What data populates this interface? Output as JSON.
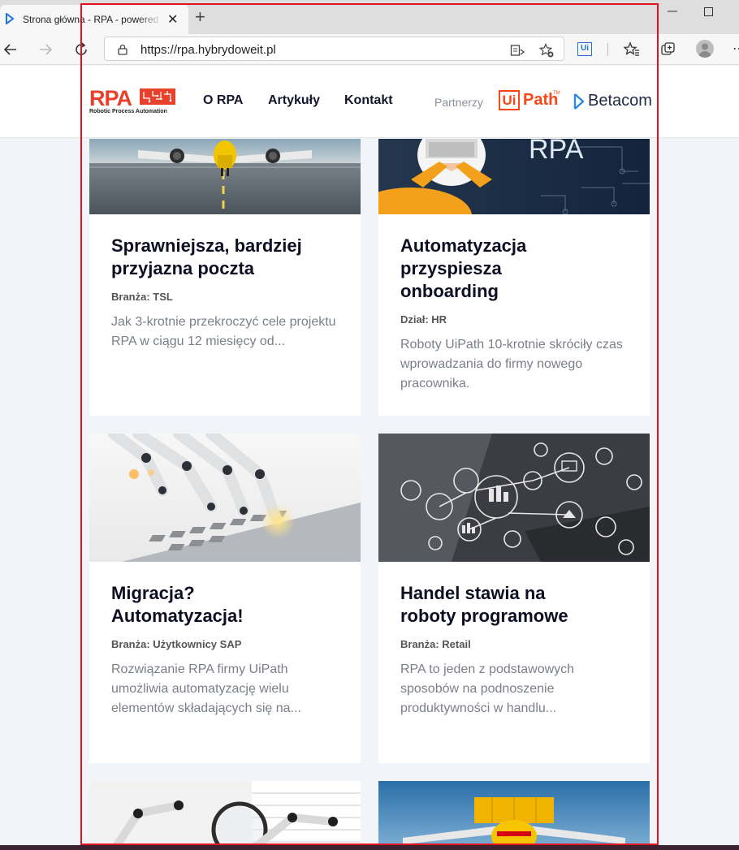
{
  "browser": {
    "tab_title": "Strona główna - RPA - powered by",
    "url": "https://rpa.hybrydoweit.pl",
    "new_tab_symbol": "+",
    "close_symbol": "✕",
    "more_symbol": "⋯"
  },
  "site": {
    "logo_text": "RPA",
    "logo_subtitle": "Robotic Process Automation",
    "nav": [
      "O RPA",
      "Artykuły",
      "Kontakt"
    ],
    "partners_label": "Partnerzy",
    "uipath_box": "Ui",
    "uipath_text": "Path",
    "uipath_tm": "TM",
    "betacom_text": "Betacom",
    "accent": "#e8412b"
  },
  "cards": [
    {
      "title_lines": [
        "Sprawniejsza, bardziej",
        "przyjazna poczta"
      ],
      "meta": "Branża: TSL",
      "excerpt_lines": [
        "Jak 3-krotnie przekroczyć cele projektu",
        "RPA w ciągu 12 miesięcy od..."
      ],
      "image": "airplane-runway"
    },
    {
      "title_lines": [
        "Automatyzacja",
        "przyspiesza",
        "onboarding"
      ],
      "meta": "Dział: HR",
      "excerpt_lines": [
        "Roboty UiPath 10-krotnie skróciły czas",
        "wprowadzania do firmy nowego",
        "pracownika."
      ],
      "image": "laptop-rpa",
      "image_text": "RPA"
    },
    {
      "title_lines": [
        "Migracja?",
        "Automatyzacja!"
      ],
      "meta": "Branża: Użytkownicy SAP",
      "excerpt_lines": [
        "Rozwiązanie RPA firmy UiPath",
        "umożliwia automatyzację wielu",
        "elementów składających się na..."
      ],
      "image": "robot-hand-keyboard"
    },
    {
      "title_lines": [
        "Handel stawia na",
        "roboty programowe"
      ],
      "meta": "Branża: Retail",
      "excerpt_lines": [
        "RPA to jeden z podstawowych",
        "sposobów na podnoszenie",
        "produktywności w handlu..."
      ],
      "image": "gears-icons"
    }
  ]
}
